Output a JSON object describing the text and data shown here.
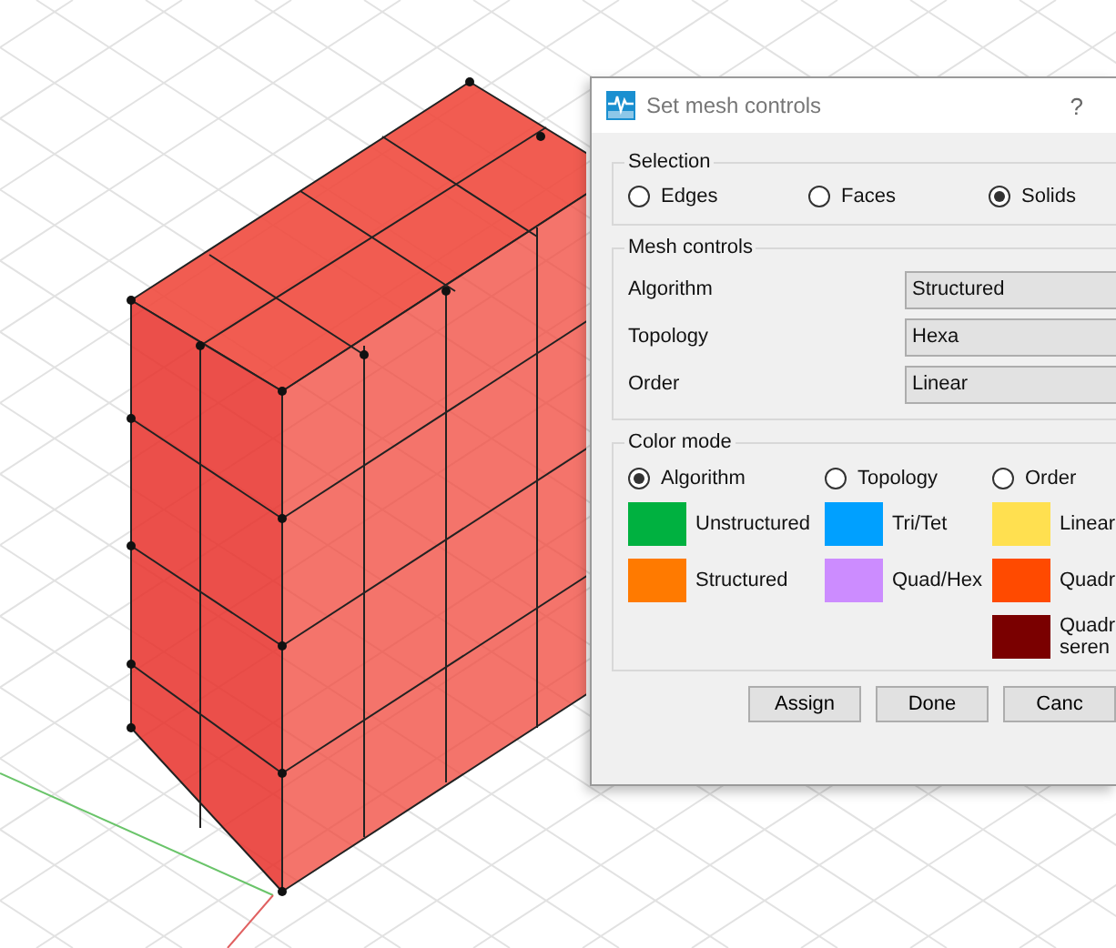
{
  "dialog": {
    "title": "Set mesh controls",
    "help": "?",
    "selection": {
      "title": "Selection",
      "options": [
        {
          "label": "Edges",
          "selected": false
        },
        {
          "label": "Faces",
          "selected": false
        },
        {
          "label": "Solids",
          "selected": true
        }
      ]
    },
    "mesh_controls": {
      "title": "Mesh controls",
      "rows": [
        {
          "label": "Algorithm",
          "value": "Structured"
        },
        {
          "label": "Topology",
          "value": "Hexa"
        },
        {
          "label": "Order",
          "value": "Linear"
        }
      ]
    },
    "color_mode": {
      "title": "Color mode",
      "columns": [
        {
          "label": "Algorithm",
          "selected": true,
          "items": [
            {
              "label": "Unstructured",
              "color": "#00b140"
            },
            {
              "label": "Structured",
              "color": "#ff7a00"
            }
          ]
        },
        {
          "label": "Topology",
          "selected": false,
          "items": [
            {
              "label": "Tri/Tet",
              "color": "#00a0ff"
            },
            {
              "label": "Quad/Hex",
              "color": "#cc8cff"
            }
          ]
        },
        {
          "label": "Order",
          "selected": false,
          "items": [
            {
              "label": "Linear",
              "color": "#ffe050"
            },
            {
              "label": "Quadr",
              "color": "#ff4a00"
            },
            {
              "label": "Quadr\nseren",
              "color": "#7a0000"
            }
          ]
        }
      ]
    },
    "buttons": [
      "Assign",
      "Done",
      "Canc"
    ]
  }
}
